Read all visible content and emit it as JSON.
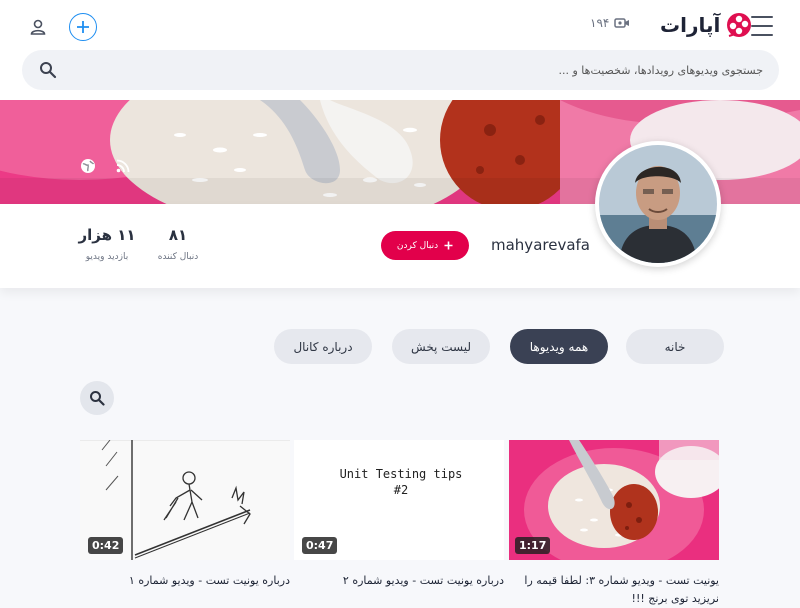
{
  "header": {
    "logo_text": "آپارات",
    "counter": "۱۹۴",
    "counter_icon": "video-camera-icon",
    "plus_icon": "plus-icon",
    "user_icon": "user-icon",
    "menu_icon": "hamburger-icon"
  },
  "search": {
    "placeholder": "جستجوی ویدیوهای رویدادها، شخصیت‌ها و ..."
  },
  "channel": {
    "username": "mahyarevafa",
    "follow_label": "دنبال کردن",
    "stats": [
      {
        "value": "۸۱",
        "label": "دنبال کننده"
      },
      {
        "value": "۱۱ هزار",
        "label": "بازدید ویدیو"
      }
    ],
    "social_icons": [
      "globe-icon",
      "rss-icon"
    ]
  },
  "tabs": [
    {
      "label": "خانه",
      "active": false
    },
    {
      "label": "همه ویدیوها",
      "active": true
    },
    {
      "label": "لیست پخش",
      "active": false
    },
    {
      "label": "درباره کانال",
      "active": false
    }
  ],
  "videos": [
    {
      "title": "یونیت تست - ویدیو شماره ۳: لطفا قیمه را نریزید توی برنج !!!",
      "duration": "1:17",
      "thumb_text": ""
    },
    {
      "title": "درباره یونیت تست - ویدیو شماره ۲",
      "duration": "0:47",
      "thumb_text": "Unit Testing tips #2"
    },
    {
      "title": "درباره یونیت تست - ویدیو شماره ۱",
      "duration": "0:42",
      "thumb_text": ""
    }
  ],
  "colors": {
    "accent": "#e2004b",
    "blue": "#1e8ef1",
    "active_tab": "#3a4154"
  }
}
